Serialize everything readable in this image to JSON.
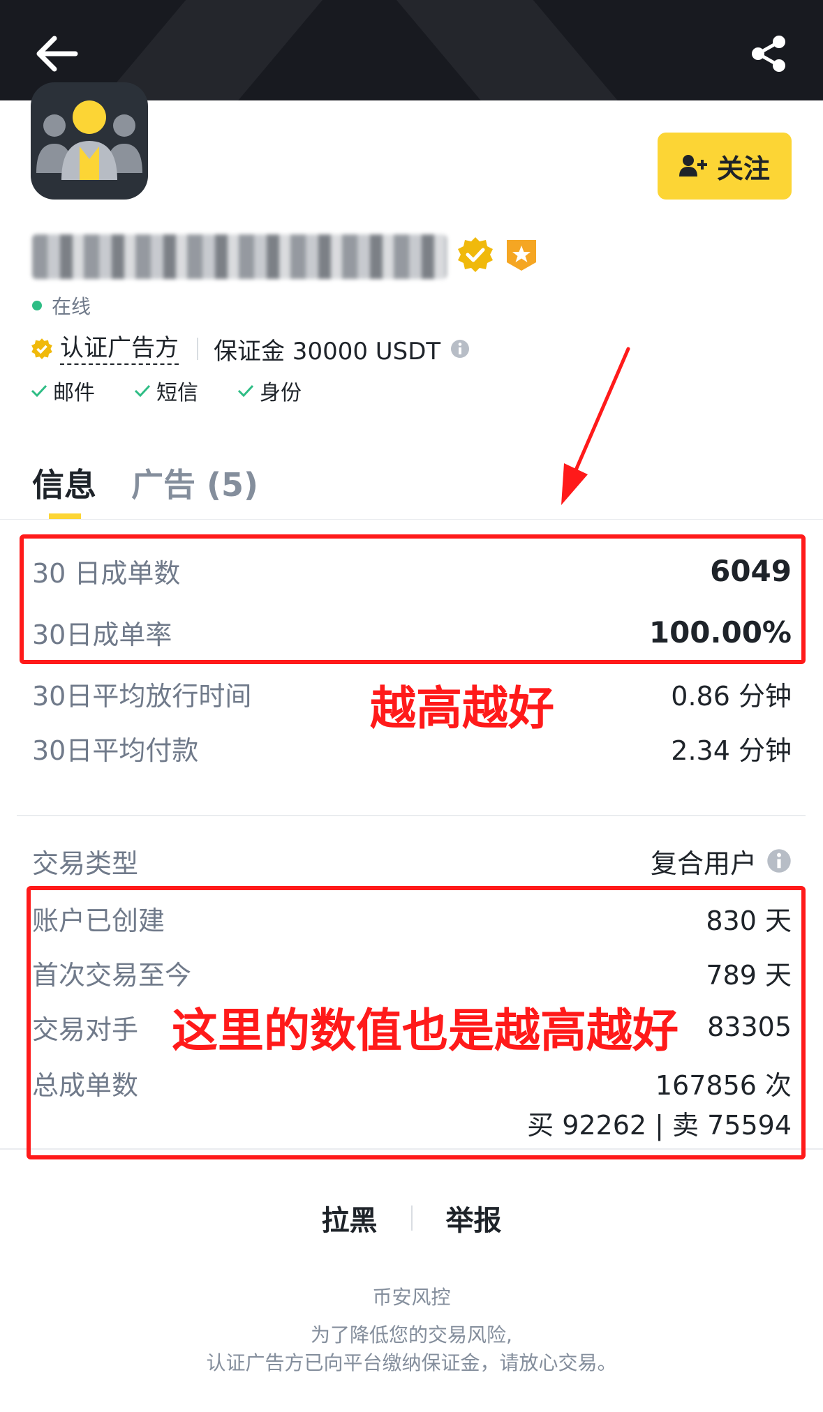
{
  "header": {
    "back_icon": "arrow-left-icon",
    "share_icon": "share-icon"
  },
  "profile": {
    "online_label": "在线",
    "cert_label": "认证广告方",
    "deposit_label": "保证金 30000 USDT",
    "checks": [
      "邮件",
      "短信",
      "身份"
    ],
    "follow_label": "关注"
  },
  "tabs": {
    "info": "信息",
    "ads": "广告 (5)"
  },
  "stats": [
    {
      "label": "30 日成单数",
      "value": "6049"
    },
    {
      "label": "30日成单率",
      "value": "100.00%"
    },
    {
      "label": "30日平均放行时间",
      "value": "0.86 分钟"
    },
    {
      "label": "30日平均付款",
      "value": "2.34 分钟"
    }
  ],
  "details": [
    {
      "label": "交易类型",
      "value": "复合用户"
    },
    {
      "label": "账户已创建",
      "value": "830 天"
    },
    {
      "label": "首次交易至今",
      "value": "789 天"
    },
    {
      "label": "交易对手",
      "value": "83305"
    },
    {
      "label": "总成单数",
      "value": "167856 次"
    }
  ],
  "total_orders_breakdown": "买 92262 | 卖 75594",
  "actions": {
    "block": "拉黑",
    "report": "举报"
  },
  "risk": {
    "title": "币安风控",
    "line1": "为了降低您的交易风险,",
    "line2": "认证广告方已向平台缴纳保证金，请放心交易。"
  },
  "annotations": {
    "a1": "越高越好",
    "a2": "这里的数值也是越高越好"
  },
  "colors": {
    "brand_yellow": "#fcd535",
    "online_green": "#2ebd85",
    "annotation_red": "#ff1a1a"
  }
}
